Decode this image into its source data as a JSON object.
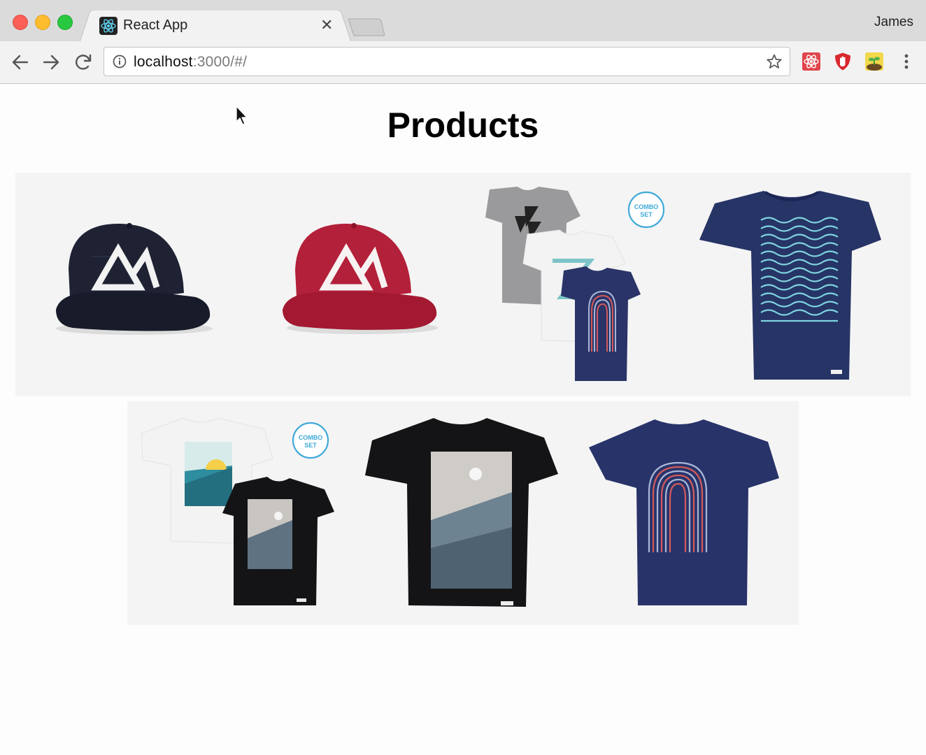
{
  "browser": {
    "tab_title": "React App",
    "profile_name": "James",
    "url_host": "localhost",
    "url_rest": ":3000/#/"
  },
  "page": {
    "title": "Products"
  },
  "products": [
    {
      "name": "navy-mountain-cap",
      "color": "#1e2233"
    },
    {
      "name": "red-mountain-cap",
      "color": "#b3203a"
    },
    {
      "name": "tee-combo-set-three",
      "badge": [
        "COMBO",
        "SET"
      ]
    },
    {
      "name": "navy-waves-tee",
      "color": "#263466"
    },
    {
      "name": "tee-combo-set-two",
      "badge": [
        "COMBO",
        "SET"
      ]
    },
    {
      "name": "black-mountain-tee",
      "color": "#141416"
    },
    {
      "name": "navy-rainbow-tee",
      "color": "#28336a"
    }
  ],
  "colors": {
    "accent_badge": "#3fa9d8",
    "page_bg": "#fdfdfd",
    "card_bg": "#f4f4f4"
  }
}
